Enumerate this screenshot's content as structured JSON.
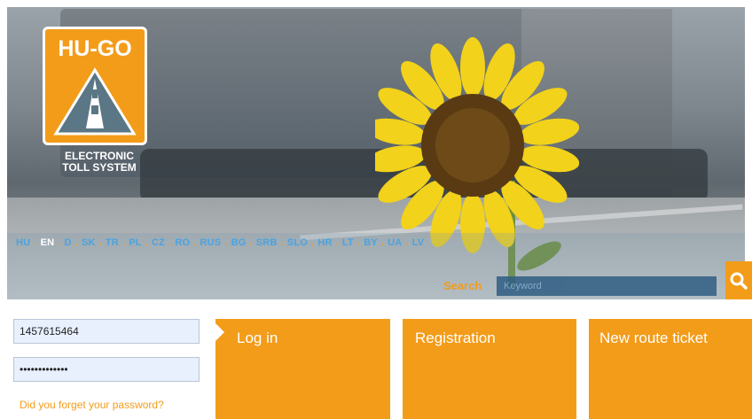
{
  "header": {
    "logo": {
      "title": "HU-GO",
      "subtitle_line1": "ELECTRONIC",
      "subtitle_line2": "TOLL SYSTEM"
    },
    "languages": [
      {
        "code": "HU",
        "active": false
      },
      {
        "code": "EN",
        "active": true
      },
      {
        "code": "D",
        "active": false
      },
      {
        "code": "SK",
        "active": false
      },
      {
        "code": "TR",
        "active": false
      },
      {
        "code": "PL",
        "active": false
      },
      {
        "code": "CZ",
        "active": false
      },
      {
        "code": "RO",
        "active": false
      },
      {
        "code": "RUS",
        "active": false
      },
      {
        "code": "BG",
        "active": false
      },
      {
        "code": "SRB",
        "active": false
      },
      {
        "code": "SLO",
        "active": false
      },
      {
        "code": "HR",
        "active": false
      },
      {
        "code": "LT",
        "active": false
      },
      {
        "code": "BY",
        "active": false
      },
      {
        "code": "UA",
        "active": false
      },
      {
        "code": "LV",
        "active": false
      }
    ],
    "search": {
      "label": "Search",
      "placeholder": "Keyword",
      "button_icon": "search-icon"
    }
  },
  "login": {
    "username_value": "1457615464",
    "password_value": "•••••••••••••",
    "forgot_link": "Did you forget your password?"
  },
  "tiles": {
    "login": "Log in",
    "registration": "Registration",
    "route_ticket": "New route ticket"
  },
  "colors": {
    "accent": "#f39c1a",
    "link": "#4aa3e0"
  }
}
